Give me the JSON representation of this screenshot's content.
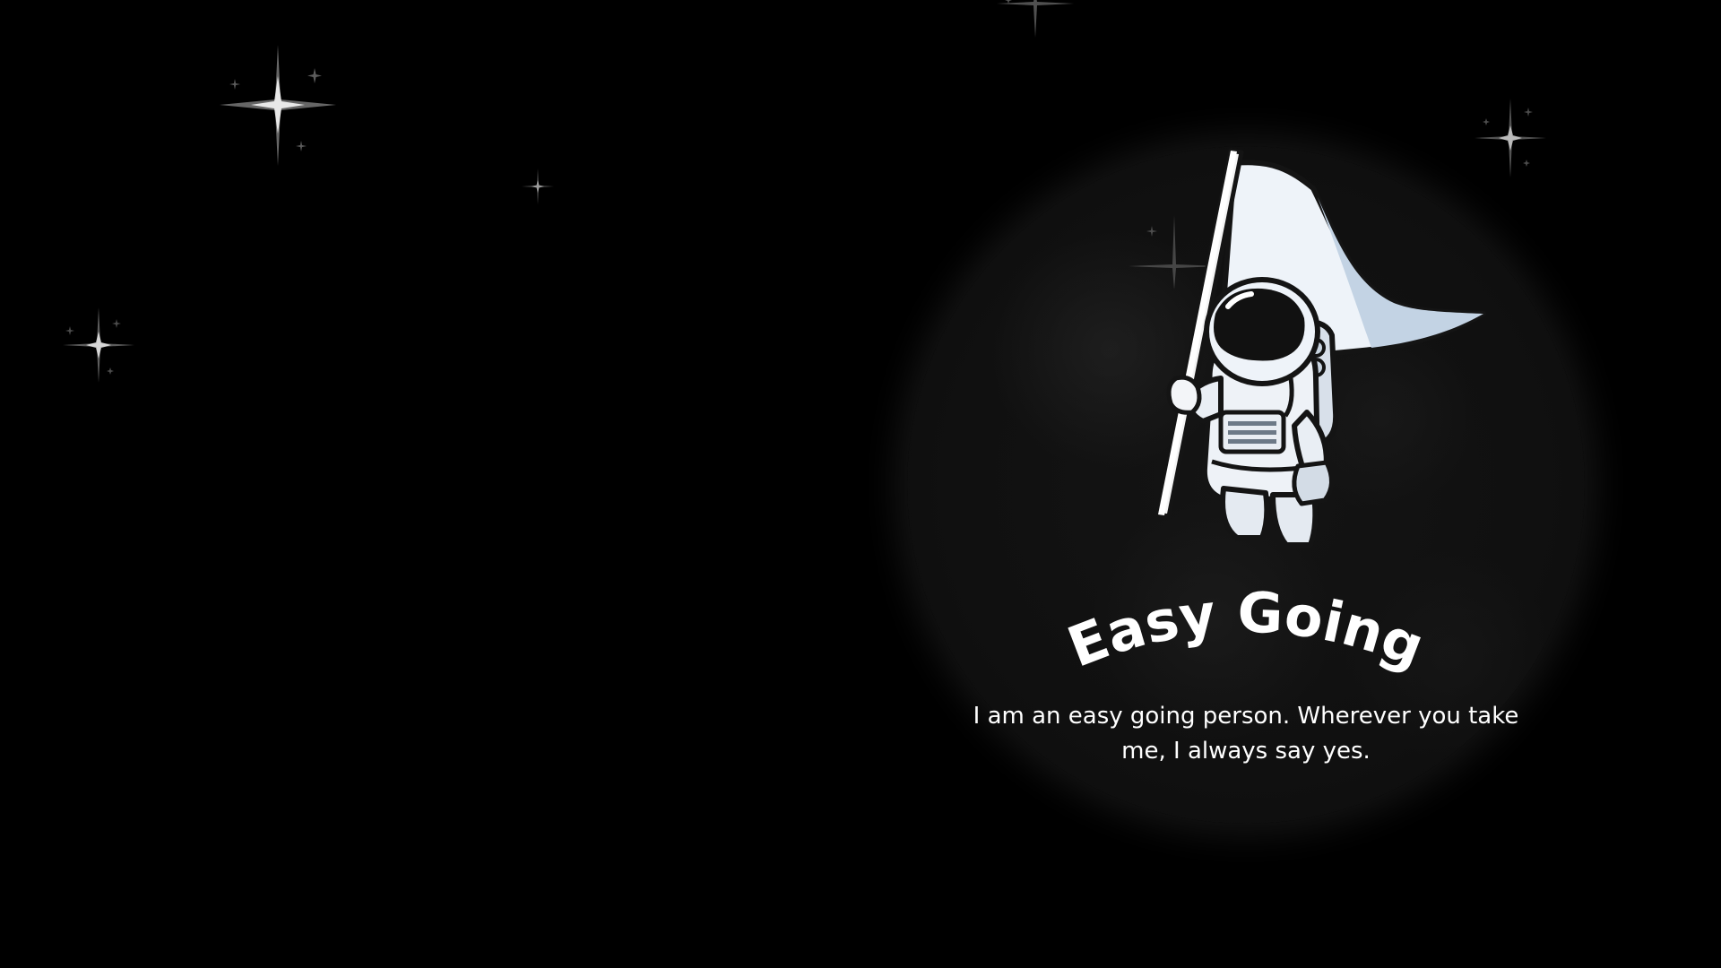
{
  "card": {
    "title": "Easy Going",
    "description": "I am an easy going person. Wherever you take me, I always say yes."
  },
  "illustration": {
    "icon": "astronaut-with-flag-icon",
    "backdrop": "moon"
  },
  "colors": {
    "background": "#000000",
    "text": "#ffffff",
    "flag": "#eef3f9",
    "flag_shade": "#c3d3e4"
  }
}
